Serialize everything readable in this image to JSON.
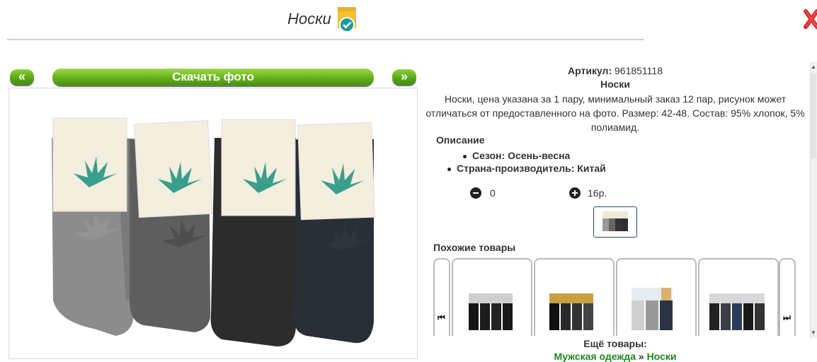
{
  "header": {
    "title": "Носки"
  },
  "image_panel": {
    "prev_label": "«",
    "next_label": "»",
    "download_label": "Скачать фото"
  },
  "product": {
    "article_label": "Артикул:",
    "article_value": "961851118",
    "name": "Носки",
    "description": "Носки, цена указана за 1 пару, минимальный заказ 12 пар, рисунок может отличаться от предоставленного на фото. Размер: 42-48. Состав: 95% хлопок, 5% полиамид.",
    "desc_heading": "Описание",
    "props": [
      "Сезон: Осень-весна",
      "Страна-производитель: Китай"
    ],
    "quantity": "0",
    "price": "16р."
  },
  "similar": {
    "heading": "Похожие товары",
    "more_heading": "Ещё товары:",
    "crumb_1": "Мужская одежда",
    "crumb_sep": "»",
    "crumb_2": "Носки"
  },
  "colors": {
    "accent_green": "#5aa817",
    "link_green": "#1d8a1d",
    "badge_yellow": "#f2c230",
    "check_teal": "#1a9aa0",
    "close_red": "#e02020"
  }
}
